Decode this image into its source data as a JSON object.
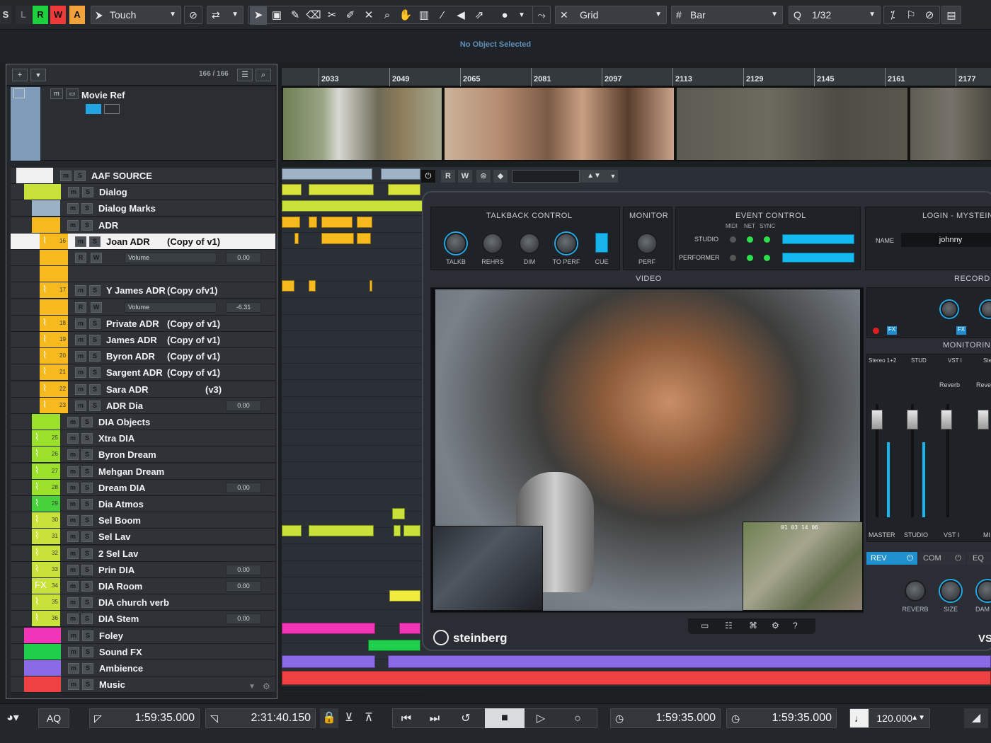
{
  "toolbar": {
    "mode_letters": [
      "S",
      "L",
      "R",
      "W",
      "A"
    ],
    "automation_mode": "Touch",
    "snap_type": "Grid",
    "grid_type": "Bar",
    "quantize": "1/32"
  },
  "status": {
    "text": "No Object Selected"
  },
  "tracklist": {
    "count": "166 / 166",
    "movie_ref": "Movie Ref",
    "rows": [
      {
        "num": "",
        "name": "AAF SOURCE",
        "color": "#f0f0f0",
        "indent": 0,
        "val": ""
      },
      {
        "num": "",
        "name": "Dialog",
        "color": "#c9e23a",
        "indent": 1,
        "val": ""
      },
      {
        "num": "",
        "name": "Dialog Marks",
        "color": "#9bb2c6",
        "indent": 2,
        "val": ""
      },
      {
        "num": "",
        "name": "ADR",
        "color": "#f6b91e",
        "indent": 2,
        "val": ""
      },
      {
        "num": "16",
        "name": "Joan ADR",
        "copy": "(Copy of v1)",
        "color": "#f6b91e",
        "indent": 3,
        "val": ""
      },
      {
        "num": "",
        "name": "",
        "color": "#f6b91e",
        "indent": 3,
        "val": "0.00",
        "param": "Volume"
      },
      {
        "num": "",
        "name": "",
        "color": "#f6b91e",
        "indent": 3,
        "val": ""
      },
      {
        "num": "17",
        "name": "Y James ADR",
        "copy": "(Copy ofv1)",
        "color": "#f6b91e",
        "indent": 3,
        "val": ""
      },
      {
        "num": "",
        "name": "",
        "color": "#f6b91e",
        "indent": 3,
        "val": "-6.31",
        "param": "Volume"
      },
      {
        "num": "18",
        "name": "Private ADR",
        "copy": "(Copy of v1)",
        "color": "#f6b91e",
        "indent": 3,
        "val": ""
      },
      {
        "num": "19",
        "name": "James ADR",
        "copy": "(Copy of v1)",
        "color": "#f6b91e",
        "indent": 3,
        "val": ""
      },
      {
        "num": "20",
        "name": "Byron ADR",
        "copy": "(Copy of v1)",
        "color": "#f6b91e",
        "indent": 3,
        "val": ""
      },
      {
        "num": "21",
        "name": "Sargent ADR",
        "copy": "(Copy of v1)",
        "color": "#f6b91e",
        "indent": 3,
        "val": ""
      },
      {
        "num": "22",
        "name": "Sara ADR",
        "copy": "(v3)",
        "color": "#f6b91e",
        "indent": 3,
        "val": ""
      },
      {
        "num": "23",
        "name": "ADR Dia",
        "color": "#f6b91e",
        "indent": 3,
        "val": "0.00"
      },
      {
        "num": "",
        "name": "DIA Objects",
        "color": "#9be02b",
        "indent": 2,
        "val": ""
      },
      {
        "num": "25",
        "name": "Xtra DIA",
        "color": "#9be02b",
        "indent": 2,
        "val": ""
      },
      {
        "num": "26",
        "name": "Byron Dream",
        "color": "#9be02b",
        "indent": 2,
        "val": ""
      },
      {
        "num": "27",
        "name": "Mehgan Dream",
        "color": "#9be02b",
        "indent": 2,
        "val": ""
      },
      {
        "num": "28",
        "name": "Dream DIA",
        "color": "#9be02b",
        "indent": 2,
        "val": "0.00"
      },
      {
        "num": "29",
        "name": "Dia Atmos",
        "color": "#47d13a",
        "indent": 2,
        "val": ""
      },
      {
        "num": "30",
        "name": "Sel Boom",
        "color": "#c9e23a",
        "indent": 2,
        "val": ""
      },
      {
        "num": "31",
        "name": "Sel Lav",
        "color": "#c9e23a",
        "indent": 2,
        "val": ""
      },
      {
        "num": "32",
        "name": "2 Sel Lav",
        "color": "#c9e23a",
        "indent": 2,
        "val": ""
      },
      {
        "num": "33",
        "name": "Prin DIA",
        "color": "#c9e23a",
        "indent": 2,
        "val": "0.00"
      },
      {
        "num": "34",
        "name": "DIA Room",
        "color": "#c9e23a",
        "indent": 2,
        "val": "0.00",
        "fx": "FX"
      },
      {
        "num": "35",
        "name": "DIA church verb",
        "color": "#c9e23a",
        "indent": 2,
        "val": ""
      },
      {
        "num": "36",
        "name": "DIA Stem",
        "color": "#c9e23a",
        "indent": 2,
        "val": "0.00"
      },
      {
        "num": "",
        "name": "Foley",
        "color": "#f035b8",
        "indent": 1,
        "val": ""
      },
      {
        "num": "",
        "name": "Sound FX",
        "color": "#1fce4a",
        "indent": 1,
        "val": ""
      },
      {
        "num": "",
        "name": "Ambience",
        "color": "#8a6ae6",
        "indent": 1,
        "val": ""
      },
      {
        "num": "",
        "name": "Music",
        "color": "#ef4141",
        "indent": 1,
        "val": ""
      }
    ]
  },
  "ruler": {
    "labels": [
      "2033",
      "2049",
      "2065",
      "2081",
      "2097",
      "2113",
      "2129",
      "2145",
      "2161",
      "2177"
    ]
  },
  "vst": {
    "brand": "steinberg",
    "corner_label": "VS",
    "talkback_title": "TALKBACK CONTROL",
    "monitor_title": "MONITOR",
    "event_title": "EVENT CONTROL",
    "login_title": "LOGIN - MYSTEIN",
    "video_title": "VIDEO",
    "record_title": "RECORD",
    "monitoring_title": "MONITORIN",
    "name_label": "NAME",
    "name_value": "johnny",
    "talkback_knobs": [
      "TALKB",
      "REHRS",
      "DIM",
      "TO PERF",
      "CUE"
    ],
    "monitor_knob": "PERF",
    "event_cols": [
      "MIDI",
      "NET",
      "SYNC"
    ],
    "event_rows": [
      "STUDIO",
      "PERFORMER"
    ],
    "channels": [
      "MASTER",
      "STUDIO",
      "VST I",
      "MI"
    ],
    "channel_tops": [
      "Stereo 1+2",
      "STUD",
      "VST I",
      "Ster"
    ],
    "reverb_labels": [
      "Reverb",
      "Reve"
    ],
    "tabs": [
      "REV",
      "COM",
      "EQ"
    ],
    "bottom_knobs": [
      "REVERB",
      "SIZE",
      "DAM"
    ],
    "toolbar_letters": [
      "R",
      "W"
    ],
    "video_timecode": "01 03 14 06"
  },
  "transport": {
    "aq": "AQ",
    "left_locator": "1:59:35.000",
    "right_locator": "2:31:40.150",
    "time_primary": "1:59:35.000",
    "time_secondary": "1:59:35.000",
    "tempo": "120.000"
  },
  "colors": {
    "accent": "#14b9f0",
    "status_text": "#5f8fb8",
    "record_red": "#e02020"
  }
}
